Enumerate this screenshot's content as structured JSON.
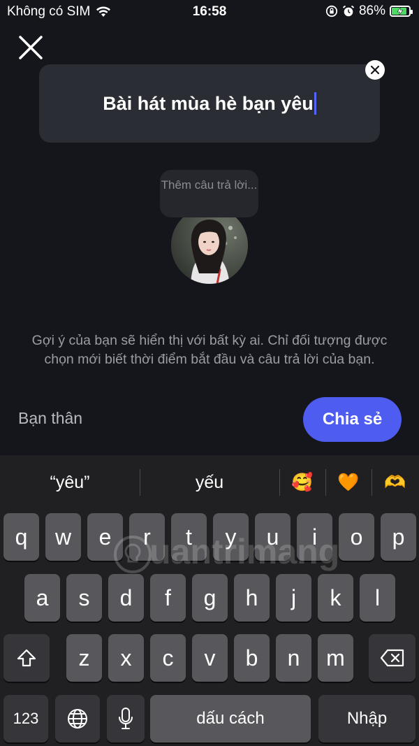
{
  "status_bar": {
    "carrier": "Không có SIM",
    "time": "16:58",
    "battery": "86%",
    "battery_level": 0.86,
    "icons": [
      "wifi-icon",
      "orientation-lock-icon",
      "alarm-icon",
      "battery-charging-icon"
    ]
  },
  "question": {
    "text": "Bài hát mùa hè bạn yêu"
  },
  "answer_bubble": {
    "placeholder": "Thêm câu trả lời..."
  },
  "hint": {
    "text": "Gợi ý của bạn sẽ hiển thị với bất kỳ ai. Chỉ đối tượng được chọn mới biết thời điểm bắt đầu và câu trả lời của bạn."
  },
  "audience": {
    "label": "Bạn thân"
  },
  "share_button": {
    "label": "Chia sẻ"
  },
  "keyboard": {
    "suggestions": [
      "“yêu”",
      "yếu"
    ],
    "emoji_suggestions": [
      "🥰",
      "🧡",
      "🫶"
    ],
    "row1": [
      "q",
      "w",
      "e",
      "r",
      "t",
      "y",
      "u",
      "i",
      "o",
      "p"
    ],
    "row2": [
      "a",
      "s",
      "d",
      "f",
      "g",
      "h",
      "j",
      "k",
      "l"
    ],
    "row3": [
      "z",
      "x",
      "c",
      "v",
      "b",
      "n",
      "m"
    ],
    "numbers_key": "123",
    "space_key": "dấu cách",
    "return_key": "Nhập"
  },
  "watermark": "uantrimang",
  "colors": {
    "background": "#15161b",
    "card": "#2b2d34",
    "accent": "#4e5cf0",
    "caret": "#5566ff",
    "keyboard": "#202022",
    "key": "#58585c"
  }
}
